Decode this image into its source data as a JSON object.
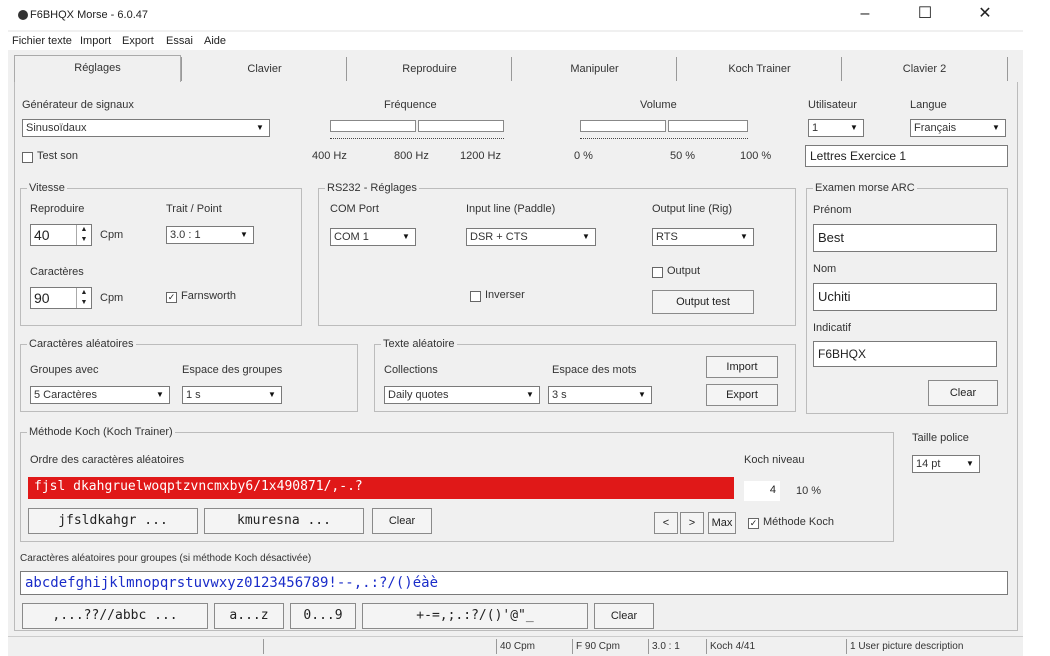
{
  "window": {
    "title": "F6BHQX Morse - 6.0.47"
  },
  "menu": [
    "Fichier texte",
    "Import",
    "Export",
    "Essai",
    "Aide"
  ],
  "tabs": [
    "Réglages",
    "Clavier",
    "Reproduire",
    "Manipuler",
    "Koch Trainer",
    "Clavier 2"
  ],
  "generator": {
    "label": "Générateur de signaux",
    "value": "Sinusoïdaux",
    "test_label": "Test son"
  },
  "frequence": {
    "label": "Fréquence",
    "ticks": [
      "400 Hz",
      "800 Hz",
      "1200 Hz"
    ]
  },
  "volume": {
    "label": "Volume",
    "ticks": [
      "0 %",
      "50 %",
      "100 %"
    ]
  },
  "utilisateur": {
    "label": "Utilisateur",
    "value": "1"
  },
  "langue": {
    "label": "Langue",
    "value": "Français"
  },
  "lettres_field": "Lettres Exercice 1",
  "vitesse": {
    "title": "Vitesse",
    "repro_label": "Reproduire",
    "repro_value": "40",
    "repro_unit": "Cpm",
    "trait_label": "Trait / Point",
    "trait_value": "3.0 : 1",
    "car_label": "Caractères",
    "car_value": "90",
    "car_unit": "Cpm",
    "farnsworth_label": "Farnsworth"
  },
  "rs232": {
    "title": "RS232 - Réglages",
    "com_label": "COM Port",
    "com_value": "COM 1",
    "input_label": "Input line (Paddle)",
    "input_value": "DSR + CTS",
    "output_label": "Output line (Rig)",
    "output_value": "RTS",
    "output_chk": "Output",
    "inverser_chk": "Inverser",
    "output_test": "Output test"
  },
  "examen": {
    "title": "Examen morse ARC",
    "prenom_label": "Prénom",
    "prenom_value": "Best",
    "nom_label": "Nom",
    "nom_value": "Uchiti",
    "indicatif_label": "Indicatif",
    "indicatif_value": "F6BHQX",
    "clear": "Clear"
  },
  "aleatoires": {
    "title": "Caractères aléatoires",
    "groupes_label": "Groupes avec",
    "groupes_value": "5 Caractères",
    "espace_label": "Espace des groupes",
    "espace_value": "1 s"
  },
  "texte": {
    "title": "Texte aléatoire",
    "collections_label": "Collections",
    "collections_value": "Daily quotes",
    "espace_mots_label": "Espace des mots",
    "espace_mots_value": "3 s",
    "import": "Import",
    "export": "Export"
  },
  "taille": {
    "label": "Taille police",
    "value": "14 pt"
  },
  "koch": {
    "title": "Méthode Koch (Koch Trainer)",
    "ordre_label": "Ordre des caractères aléatoires",
    "ordre_value": "fjsl  dkahgruelwoqptzvncmxby6/1x490871/,-.?",
    "btn1": "jfsldkahgr ...",
    "btn2": "kmuresna ...",
    "clear": "Clear",
    "prev": "<",
    "next": ">",
    "max": "Max",
    "niveau_label": "Koch niveau",
    "niveau_value": "4",
    "pct_value": "10 %",
    "methode_label": "Méthode Koch"
  },
  "groupes_chars": {
    "label": "Caractères aléatoires pour groupes (si méthode Koch désactivée)",
    "value": "abcdefghijklmnopqrstuvwxyz0123456789!--,.:?/()éàè",
    "btn1": ",...??//abbc ...",
    "btn2": "a...z",
    "btn3": "0...9",
    "btn4": "+-=,;.:?/()'@\"_",
    "clear": "Clear"
  },
  "status": [
    "40 Cpm",
    "F 90 Cpm",
    "3.0 : 1",
    "Koch 4/41",
    "1 User picture description"
  ]
}
